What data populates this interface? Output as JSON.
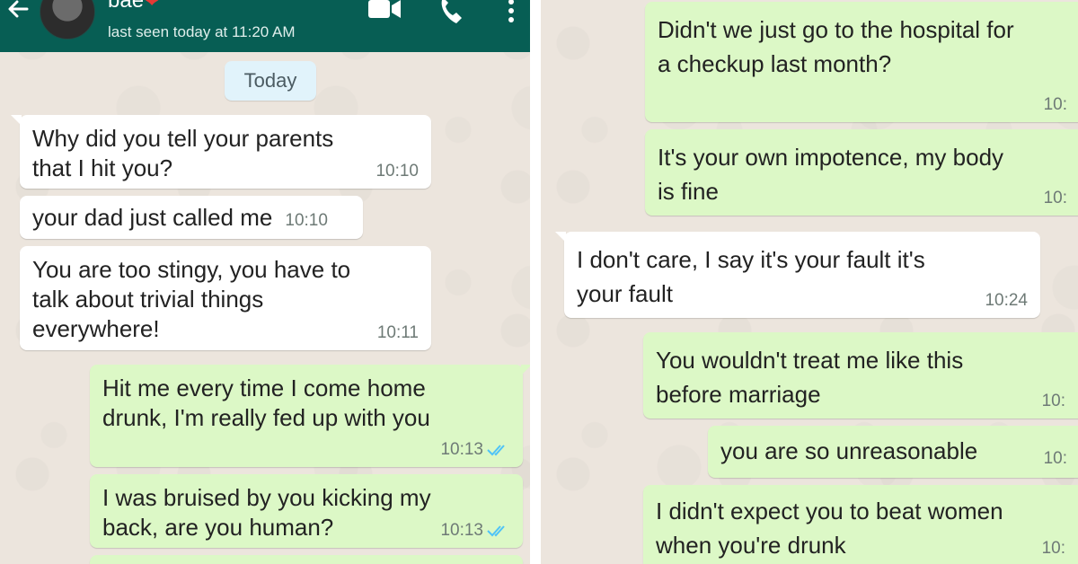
{
  "left_chat": {
    "header": {
      "contact_name": "bae",
      "heart": "❤",
      "status": "last seen today at 11:20 AM"
    },
    "date_chip": "Today",
    "messages": [
      {
        "text": "Why did you tell your parents that I hit you?",
        "time": "10:10",
        "direction": "incoming"
      },
      {
        "text": "your dad just called me",
        "time": "10:10",
        "direction": "incoming"
      },
      {
        "text": "You are too stingy, you have to talk about trivial things everywhere!",
        "time": "10:11",
        "direction": "incoming"
      },
      {
        "text": "Hit me every time I come home drunk, I'm really fed up with you",
        "time": "10:13",
        "direction": "outgoing",
        "read": true
      },
      {
        "text": "I was bruised by you kicking my back, are you human?",
        "time": "10:13",
        "direction": "outgoing",
        "read": true
      }
    ]
  },
  "right_chat": {
    "messages": [
      {
        "text": "Didn't we just go to the hospital for a checkup last month?",
        "time": "10:",
        "direction": "outgoing"
      },
      {
        "text": "It's your own impotence, my body is fine",
        "time": "10:",
        "direction": "outgoing"
      },
      {
        "text": "I don't care, I say it's your fault it's your fault",
        "time": "10:24",
        "direction": "incoming"
      },
      {
        "text": "You wouldn't treat me like this before marriage",
        "time": "10:",
        "direction": "outgoing"
      },
      {
        "text": "you are so unreasonable",
        "time": "10:",
        "direction": "outgoing"
      },
      {
        "text": "I didn't expect you to beat women when you're drunk",
        "time": "10:",
        "direction": "outgoing"
      }
    ]
  },
  "colors": {
    "header": "#075e54",
    "chat_background": "#ece5dd",
    "outgoing_bubble": "#dcf8c6",
    "incoming_bubble": "#ffffff",
    "read_ticks": "#4fc3f7",
    "date_chip": "#e1f3fb"
  },
  "icons": [
    "back-arrow-icon",
    "video-call-icon",
    "phone-icon",
    "more-options-icon",
    "double-check-icon"
  ]
}
